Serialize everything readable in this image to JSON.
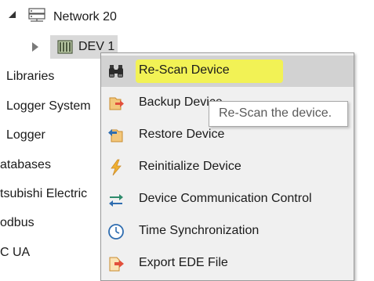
{
  "tree": {
    "network": {
      "label": "Network 20",
      "icon": "network-icon"
    },
    "device": {
      "label": "DEV 1",
      "icon": "device-icon"
    },
    "left_items": [
      {
        "label": "Libraries"
      },
      {
        "label": "Logger System"
      },
      {
        "label": "Logger"
      },
      {
        "label": "atabases"
      },
      {
        "label": "tsubishi Electric"
      },
      {
        "label": "odbus"
      },
      {
        "label": "C UA"
      }
    ]
  },
  "context_menu": {
    "items": [
      {
        "label": "Re-Scan Device",
        "icon": "binoculars-icon",
        "highlighted": true
      },
      {
        "label": "Backup Device",
        "icon": "backup-icon"
      },
      {
        "label": "Restore Device",
        "icon": "restore-icon"
      },
      {
        "label": "Reinitialize Device",
        "icon": "lightning-icon"
      },
      {
        "label": "Device Communication Control",
        "icon": "communication-arrows-icon"
      },
      {
        "label": "Time Synchronization",
        "icon": "clock-icon"
      },
      {
        "label": "Export EDE File",
        "icon": "export-icon"
      }
    ]
  },
  "tooltip": {
    "text": "Re-Scan the device."
  },
  "colors": {
    "marker_yellow": "#f2f255",
    "menu_background": "#f0f0f0",
    "menu_hover": "#d2d2d2",
    "icon_blue": "#2f6db0",
    "icon_orange": "#e8a23a"
  }
}
